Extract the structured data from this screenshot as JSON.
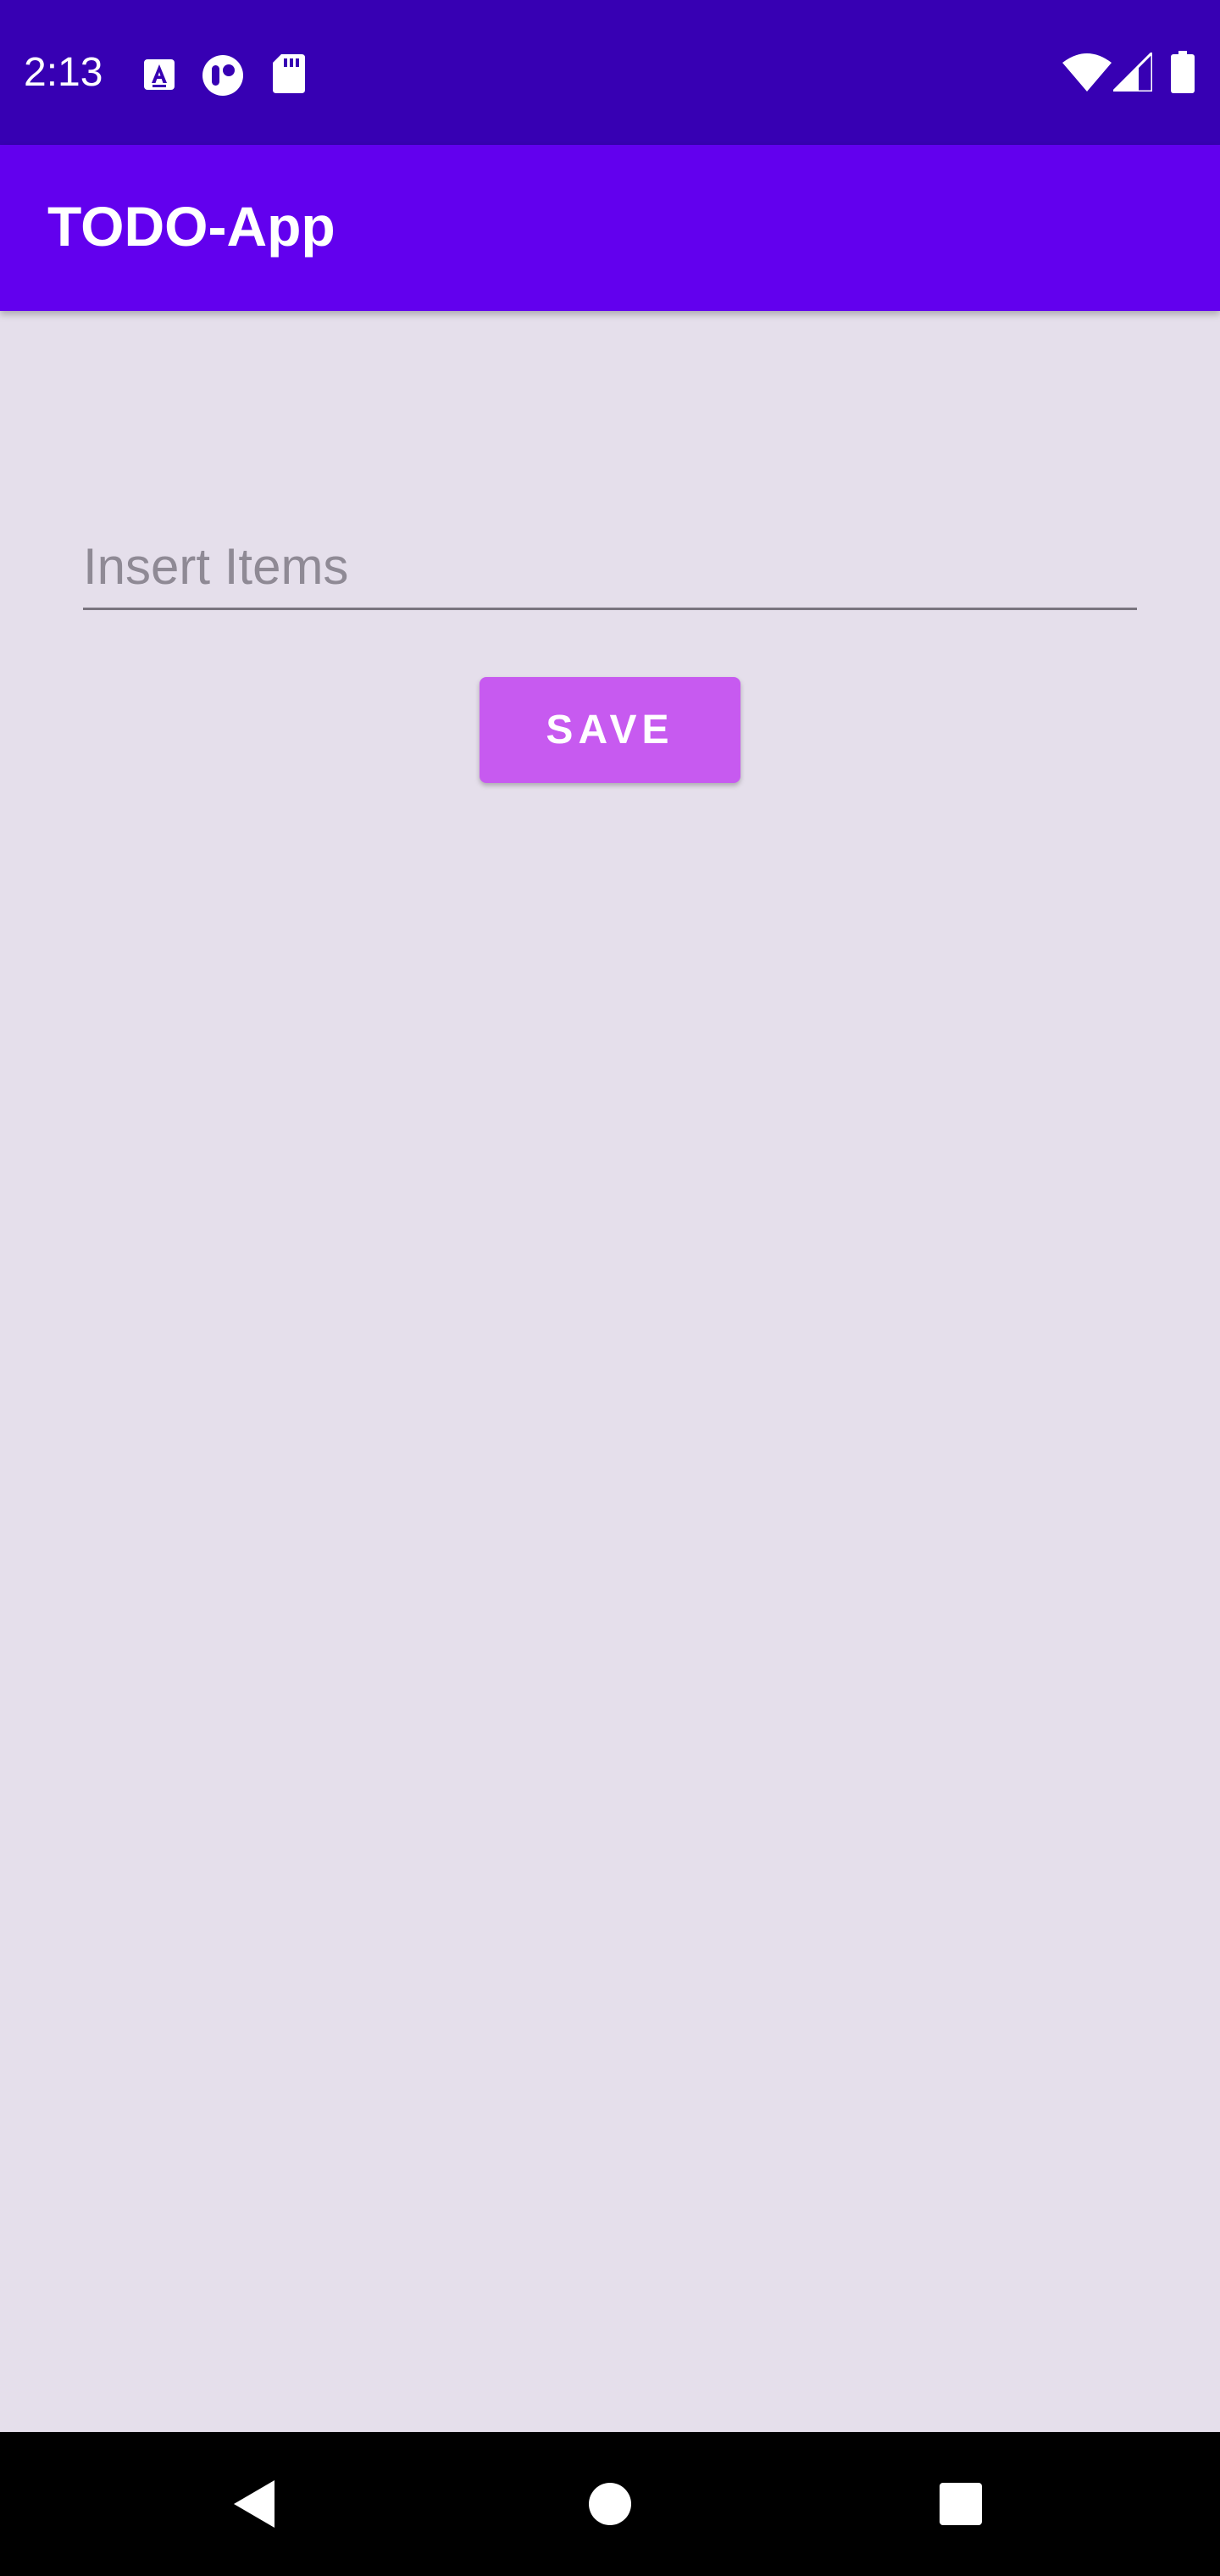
{
  "status_bar": {
    "time": "2:13",
    "left_icons": [
      "keyboard-a-icon",
      "media-app-icon",
      "sd-card-icon"
    ],
    "right_icons": [
      "wifi-icon",
      "cellular-signal-icon",
      "battery-icon"
    ],
    "background_color": "#3700b3"
  },
  "app_bar": {
    "title": "TODO-App",
    "background_color": "#6200ee"
  },
  "form": {
    "input_placeholder": "Insert Items",
    "input_value": "",
    "save_label": "SAVE",
    "save_button_color": "#c75af0"
  },
  "nav_bar": {
    "buttons": [
      "back-icon",
      "home-icon",
      "recents-icon"
    ]
  },
  "colors": {
    "page_background": "#e5dfeb"
  }
}
